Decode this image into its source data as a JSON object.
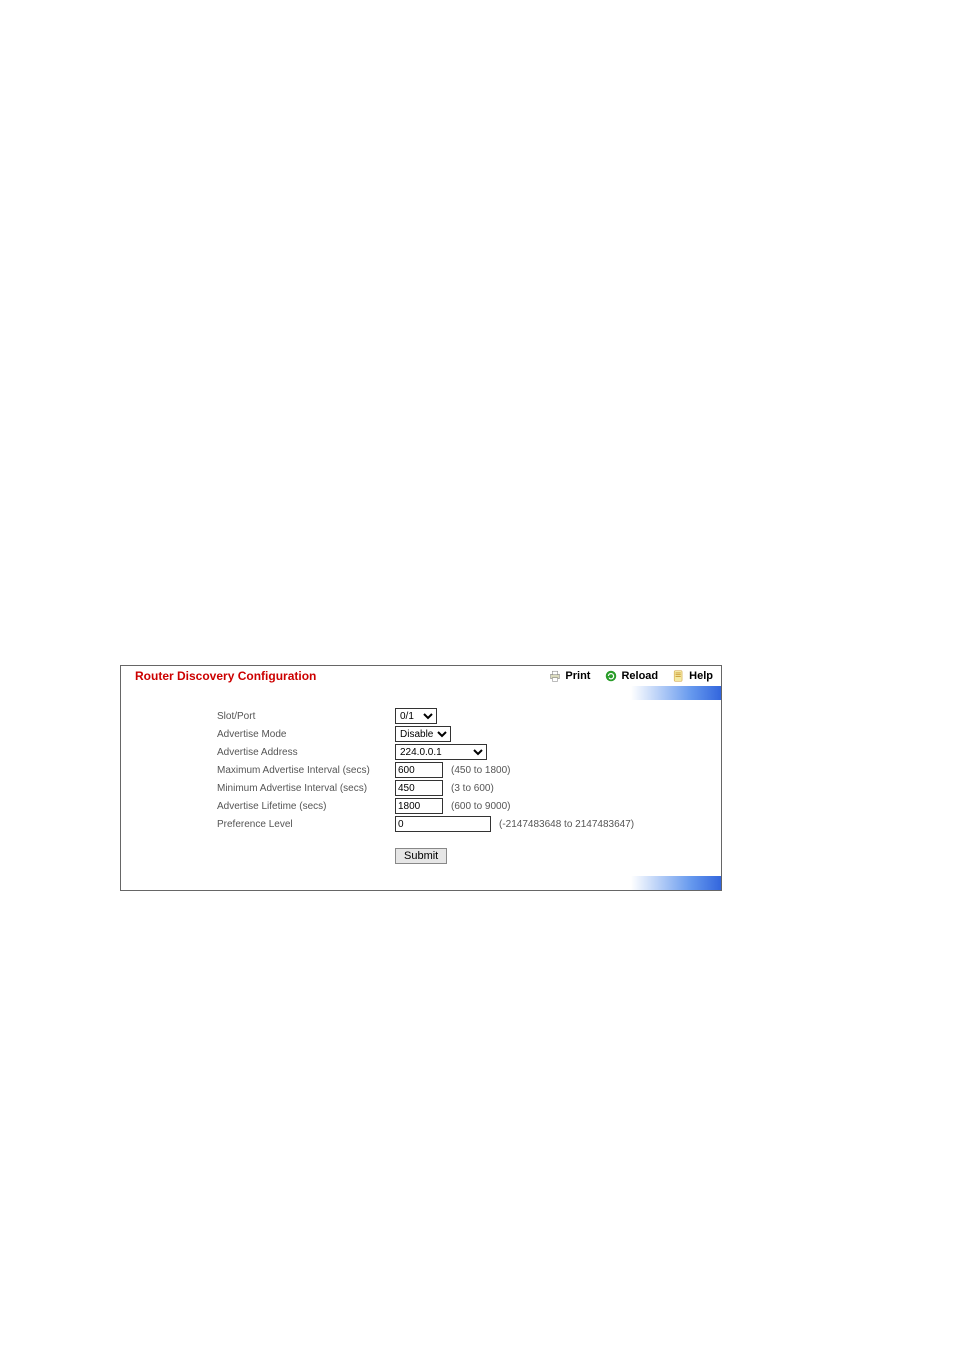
{
  "header": {
    "title": "Router Discovery Configuration",
    "actions": {
      "print": "Print",
      "reload": "Reload",
      "help": "Help"
    }
  },
  "form": {
    "slot_port": {
      "label": "Slot/Port",
      "value": "0/1"
    },
    "advertise_mode": {
      "label": "Advertise Mode",
      "value": "Disable"
    },
    "advertise_addr": {
      "label": "Advertise Address",
      "value": "224.0.0.1"
    },
    "max_interval": {
      "label": "Maximum Advertise Interval (secs)",
      "value": "600",
      "hint": "(450 to 1800)"
    },
    "min_interval": {
      "label": "Minimum Advertise Interval (secs)",
      "value": "450",
      "hint": "(3 to 600)"
    },
    "lifetime": {
      "label": "Advertise Lifetime (secs)",
      "value": "1800",
      "hint": "(600 to 9000)"
    },
    "preference": {
      "label": "Preference Level",
      "value": "0",
      "hint": "(-2147483648 to 2147483647)"
    }
  },
  "buttons": {
    "submit": "Submit"
  }
}
